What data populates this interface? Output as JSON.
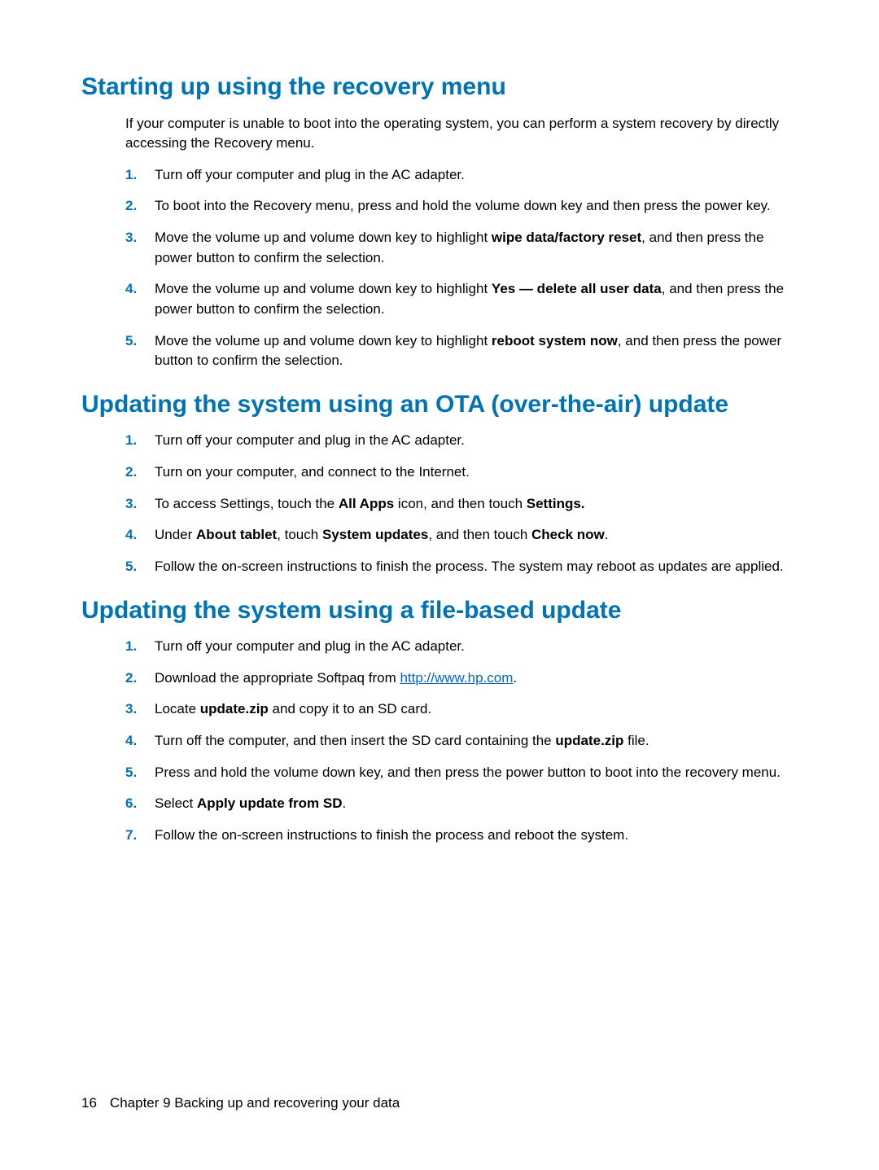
{
  "section1": {
    "title": "Starting up using the recovery menu",
    "intro": "If your computer is unable to boot into the operating system, you can perform a system recovery by directly accessing the Recovery menu.",
    "steps": {
      "1": {
        "num": "1.",
        "a": "Turn off your computer and plug in the AC adapter."
      },
      "2": {
        "num": "2.",
        "a": "To boot into the Recovery menu, press and hold the volume down key and then press the power key."
      },
      "3": {
        "num": "3.",
        "a": "Move the volume up and volume down key to highlight ",
        "b": "wipe data/factory reset",
        "c": ", and then press the power button to confirm the selection."
      },
      "4": {
        "num": "4.",
        "a": "Move the volume up and volume down key to highlight ",
        "b": "Yes — delete all user data",
        "c": ", and then press the power button to confirm the selection."
      },
      "5": {
        "num": "5.",
        "a": "Move the volume up and volume down key to highlight ",
        "b": "reboot system now",
        "c": ", and then press the power button to confirm the selection."
      }
    }
  },
  "section2": {
    "title": "Updating the system using an OTA (over-the-air) update",
    "steps": {
      "1": {
        "num": "1.",
        "a": "Turn off your computer and plug in the AC adapter."
      },
      "2": {
        "num": "2.",
        "a": "Turn on your computer, and connect to the Internet."
      },
      "3": {
        "num": "3.",
        "a": "To access Settings, touch the ",
        "b": "All Apps",
        "c": " icon, and then touch ",
        "d": "Settings."
      },
      "4": {
        "num": "4.",
        "a": "Under ",
        "b": "About tablet",
        "c": ", touch ",
        "d": "System updates",
        "e": ", and then touch ",
        "f": "Check now",
        "g": "."
      },
      "5": {
        "num": "5.",
        "a": "Follow the on-screen instructions to finish the process. The system may reboot as updates are applied."
      }
    }
  },
  "section3": {
    "title": "Updating the system using a file-based update",
    "steps": {
      "1": {
        "num": "1.",
        "a": "Turn off your computer and plug in the AC adapter."
      },
      "2": {
        "num": "2.",
        "a": "Download the appropriate Softpaq from ",
        "link": "http://www.hp.com",
        "c": "."
      },
      "3": {
        "num": "3.",
        "a": "Locate ",
        "b": "update.zip",
        "c": " and copy it to an SD card."
      },
      "4": {
        "num": "4.",
        "a": "Turn off the computer, and then insert the SD card containing the ",
        "b": "update.zip",
        "c": " file."
      },
      "5": {
        "num": "5.",
        "a": "Press and hold the volume down key, and then press the power button to boot into the recovery menu."
      },
      "6": {
        "num": "6.",
        "a": "Select ",
        "b": "Apply update from SD",
        "c": "."
      },
      "7": {
        "num": "7.",
        "a": "Follow the on-screen instructions to finish the process and reboot the system."
      }
    }
  },
  "footer": {
    "page": "16",
    "chapter": "Chapter 9   Backing up and recovering your data"
  }
}
